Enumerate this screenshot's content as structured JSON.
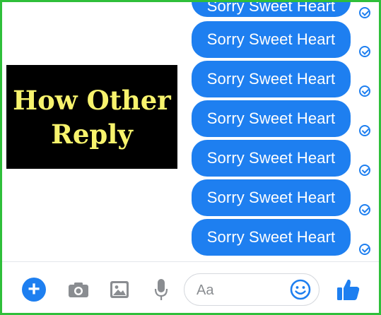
{
  "messages": [
    {
      "text": "Sorry Sweet Heart",
      "partial": true
    },
    {
      "text": "Sorry Sweet Heart"
    },
    {
      "text": "Sorry Sweet Heart"
    },
    {
      "text": "Sorry Sweet Heart"
    },
    {
      "text": "Sorry Sweet Heart"
    },
    {
      "text": "Sorry Sweet Heart"
    },
    {
      "text": "Sorry Sweet Heart"
    }
  ],
  "overlay": {
    "line1": "How Other",
    "line2": "Reply"
  },
  "composer": {
    "plus_icon": "plus-circle-icon",
    "camera_icon": "camera-icon",
    "gallery_icon": "image-icon",
    "mic_icon": "microphone-icon",
    "input_placeholder": "Aa",
    "emoji_icon": "smiley-icon",
    "like_icon": "thumbs-up-icon"
  },
  "colors": {
    "accent": "#1e7ff0",
    "frame": "#2fbf3a",
    "overlay_bg": "#000000",
    "overlay_text": "#f7f36d"
  }
}
